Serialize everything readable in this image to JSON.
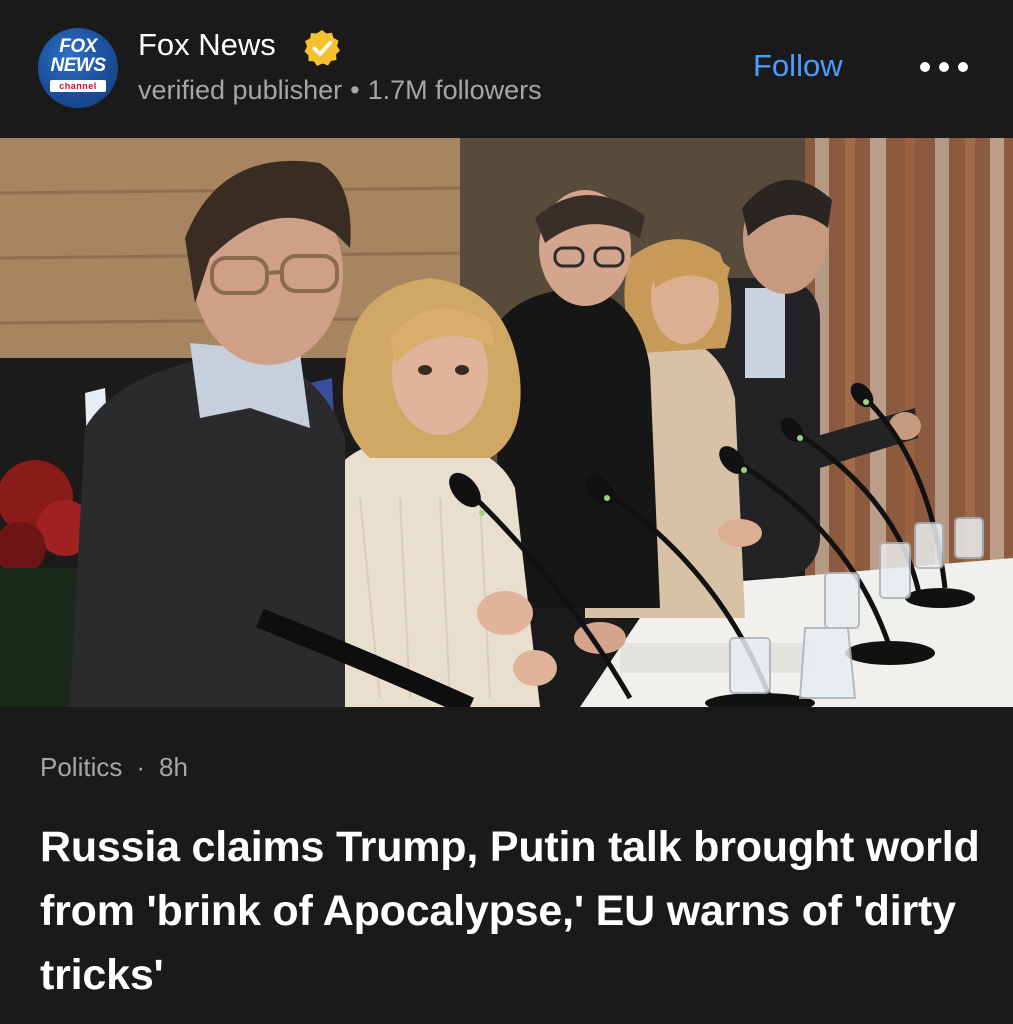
{
  "publisher": {
    "name": "Fox News",
    "verified": true,
    "descriptor": "verified publisher",
    "separator": "•",
    "followers": "1.7M followers",
    "logo_text_top": "FOX",
    "logo_text_mid": "NEWS",
    "logo_text_bottom": "channel"
  },
  "actions": {
    "follow_label": "Follow",
    "more_icon": "more-horizontal-icon"
  },
  "article": {
    "category": "Politics",
    "dot": "·",
    "age": "8h",
    "headline": "Russia claims Trump, Putin talk brought world from 'brink of Apocalypse,' EU warns of 'dirty tricks'"
  },
  "colors": {
    "background": "#1a1a1a",
    "accent": "#4a9cff",
    "secondary_text": "#a6a6a6",
    "verified_badge": "#f5c12e"
  }
}
